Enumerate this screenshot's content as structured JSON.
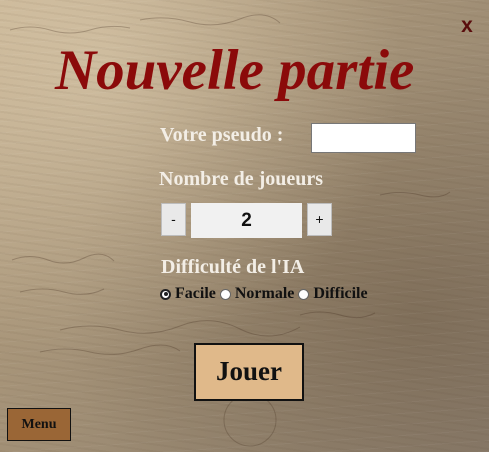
{
  "dialog": {
    "title": "Nouvelle partie",
    "close_label": "x"
  },
  "pseudo": {
    "label": "Votre pseudo :",
    "value": ""
  },
  "players": {
    "label": "Nombre de joueurs",
    "decrement_label": "-",
    "increment_label": "+",
    "count": "2"
  },
  "difficulty": {
    "label": "Difficulté de l'IA",
    "options": [
      "Facile",
      "Normale",
      "Difficile"
    ],
    "selected": "Facile"
  },
  "actions": {
    "play_label": "Jouer",
    "menu_label": "Menu"
  },
  "colors": {
    "title": "#8b0a0a",
    "play_button": "#e0b98a",
    "menu_button": "#9a6636",
    "label_text": "#f3eee6"
  }
}
